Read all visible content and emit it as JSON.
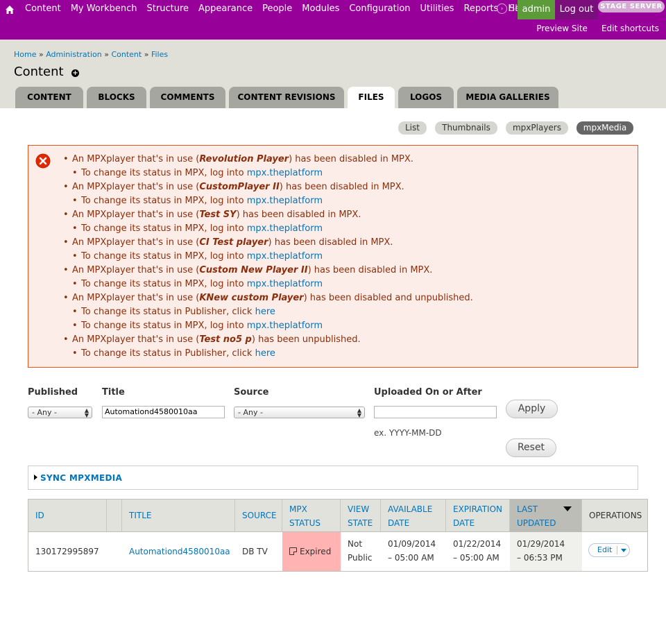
{
  "toolbar": {
    "menu": [
      "Content",
      "My Workbench",
      "Structure",
      "Appearance",
      "People",
      "Modules",
      "Configuration",
      "Utilities",
      "Reports",
      "Help"
    ],
    "shortcuts": "Shortcuts",
    "admin": "admin",
    "logout": "Log out",
    "stage": "STAGE SERVER",
    "preview": "Preview Site",
    "edit_shortcuts": "Edit shortcuts"
  },
  "breadcrumb": {
    "items": [
      "Home",
      "Administration",
      "Content",
      "Files"
    ],
    "sep": "»"
  },
  "page_title": "Content",
  "tabs": [
    "CONTENT",
    "BLOCKS",
    "COMMENTS",
    "CONTENT REVISIONS",
    "FILES",
    "LOGOS",
    "MEDIA GALLERIES"
  ],
  "secondary_tabs": [
    "List",
    "Thumbnails",
    "mpxPlayers",
    "mpxMedia"
  ],
  "messages": [
    {
      "pre": "An MPXplayer that's in use (",
      "name": "Revolution Player",
      "post": ") has been disabled in MPX."
    },
    {
      "sub": "To change its status in MPX, log into ",
      "link": "mpx.theplatform"
    },
    {
      "pre": "An MPXplayer that's in use (",
      "name": "CustomPlayer II",
      "post": ") has been disabled in MPX."
    },
    {
      "sub": "To change its status in MPX, log into ",
      "link": "mpx.theplatform"
    },
    {
      "pre": "An MPXplayer that's in use (",
      "name": "Test SY",
      "post": ") has been disabled in MPX."
    },
    {
      "sub": "To change its status in MPX, log into ",
      "link": "mpx.theplatform"
    },
    {
      "pre": "An MPXplayer that's in use (",
      "name": "CI Test player",
      "post": ") has been disabled in MPX."
    },
    {
      "sub": "To change its status in MPX, log into ",
      "link": "mpx.theplatform"
    },
    {
      "pre": "An MPXplayer that's in use (",
      "name": "Custom New Player II",
      "post": ") has been disabled in MPX."
    },
    {
      "sub": "To change its status in MPX, log into ",
      "link": "mpx.theplatform"
    },
    {
      "pre": "An MPXplayer that's in use (",
      "name": "KNew custom Player",
      "post": ") has been disabled and unpublished."
    },
    {
      "sub": "To change its status in Publisher, click ",
      "link": "here"
    },
    {
      "sub": "To change its status in MPX, log into ",
      "link": "mpx.theplatform"
    },
    {
      "pre": "An MPXplayer that's in use (",
      "name": "Test no5 p",
      "post": ") has been unpublished."
    },
    {
      "sub": "To change its status in Publisher, click ",
      "link": "here"
    }
  ],
  "filters": {
    "published_label": "Published",
    "published_value": "- Any -",
    "title_label": "Title",
    "title_value": "Automationd4580010aa",
    "source_label": "Source",
    "source_value": "- Any -",
    "uploaded_label": "Uploaded On or After",
    "uploaded_value": "",
    "date_hint": "ex. YYYY-MM-DD",
    "apply": "Apply",
    "reset": "Reset"
  },
  "sync_legend": "SYNC MPXMEDIA",
  "table": {
    "headers": {
      "id": "ID",
      "title": "TITLE",
      "source": "SOURCE",
      "status": [
        "MPX",
        "STATUS"
      ],
      "view": [
        "VIEW",
        "STATE"
      ],
      "available": [
        "AVAILABLE",
        "DATE"
      ],
      "expiration": [
        "EXPIRATION",
        "DATE"
      ],
      "updated": [
        "LAST",
        "UPDATED"
      ],
      "operations": "OPERATIONS"
    },
    "rows": [
      {
        "id": "130172995897",
        "title": "Automationd4580010aa",
        "source": "DB TV",
        "status": "Expired",
        "view": [
          "Not",
          "Public"
        ],
        "available": [
          "01/09/2014",
          "– 05:00 AM"
        ],
        "expiration": [
          "01/22/2014",
          "– 05:00 AM"
        ],
        "updated": [
          "01/29/2014",
          "– 06:53 PM"
        ],
        "op": "Edit"
      }
    ]
  }
}
